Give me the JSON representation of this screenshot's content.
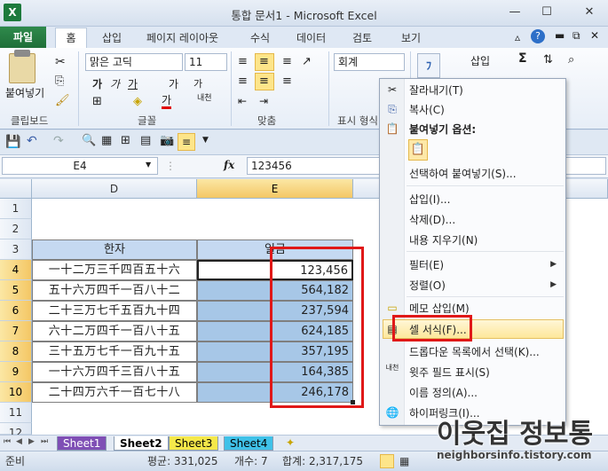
{
  "window": {
    "title": "통합 문서1 - Microsoft Excel",
    "app_icon": "X"
  },
  "ribbon_tabs": [
    {
      "label": "파일"
    },
    {
      "label": "홈"
    },
    {
      "label": "삽입"
    },
    {
      "label": "페이지 레이아웃"
    },
    {
      "label": "수식"
    },
    {
      "label": "데이터"
    },
    {
      "label": "검토"
    },
    {
      "label": "보기"
    }
  ],
  "ribbon": {
    "clipboard": {
      "paste_label": "붙여넣기",
      "group_label": "클립보드"
    },
    "font": {
      "name": "맑은 고딕",
      "size": "11",
      "bold": "가",
      "italic": "가",
      "underline": "가",
      "grow": "가",
      "shrink": "가",
      "group_label": "글꼴",
      "font_color_glyph": "가",
      "phonetic": "내천"
    },
    "alignment": {
      "group_label": "맞춤"
    },
    "number": {
      "format": "회계",
      "group_label": "표시 형식"
    },
    "cells": {
      "insert_label": "삽입"
    },
    "editing": {
      "sum_glyph": "Σ"
    }
  },
  "formula_bar": {
    "name_box": "E4",
    "fx": "fx",
    "value": "123456"
  },
  "grid": {
    "columns": [
      "D",
      "E"
    ],
    "rows": [
      "1",
      "2",
      "3",
      "4",
      "5",
      "6",
      "7",
      "8",
      "9",
      "10",
      "11",
      "12"
    ],
    "header_row": {
      "col_d": "한자",
      "col_e": "일금"
    },
    "data": [
      {
        "hanja": "一十二万三千四百五十六",
        "amount": "123,456"
      },
      {
        "hanja": "五十六万四千一百八十二",
        "amount": "564,182"
      },
      {
        "hanja": "二十三万七千五百九十四",
        "amount": "237,594"
      },
      {
        "hanja": "六十二万四千一百八十五",
        "amount": "624,185"
      },
      {
        "hanja": "三十五万七千一百九十五",
        "amount": "357,195"
      },
      {
        "hanja": "一十六万四千三百八十五",
        "amount": "164,385"
      },
      {
        "hanja": "二十四万六千一百七十八",
        "amount": "246,178"
      }
    ]
  },
  "sheets": [
    "Sheet1",
    "Sheet2",
    "Sheet3",
    "Sheet4"
  ],
  "active_sheet": "Sheet2",
  "status": {
    "ready": "준비",
    "average": "평균: 331,025",
    "count": "개수: 7",
    "sum": "합계: 2,317,175"
  },
  "context_menu": {
    "items": [
      {
        "label": "잘라내기(T)",
        "icon": "scissors-icon"
      },
      {
        "label": "복사(C)",
        "icon": "copy-icon"
      },
      {
        "label": "붙여넣기 옵션:",
        "icon": "paste-icon"
      },
      {
        "label": "선택하여 붙여넣기(S)..."
      },
      {
        "label": "삽입(I)..."
      },
      {
        "label": "삭제(D)..."
      },
      {
        "label": "내용 지우기(N)"
      },
      {
        "label": "필터(E)",
        "submenu": true
      },
      {
        "label": "정렬(O)",
        "submenu": true
      },
      {
        "label": "메모 삽입(M)",
        "icon": "comment-icon"
      },
      {
        "label": "셀 서식(F)...",
        "icon": "format-cells-icon"
      },
      {
        "label": "드롭다운 목록에서 선택(K)..."
      },
      {
        "label": "윗주 필드 표시(S)",
        "icon": "phonetic-icon"
      },
      {
        "label": "이름 정의(A)..."
      },
      {
        "label": "하이퍼링크(I)...",
        "icon": "hyperlink-icon"
      }
    ]
  },
  "watermark": {
    "line1": "이웃집 정보통",
    "line2": "neighborsinfo.tistory.com"
  },
  "colors": {
    "selection": "#a7c7e7",
    "header_fill": "#c5d9f1",
    "highlight_red": "#e01818",
    "file_tab": "#1f6f38"
  }
}
